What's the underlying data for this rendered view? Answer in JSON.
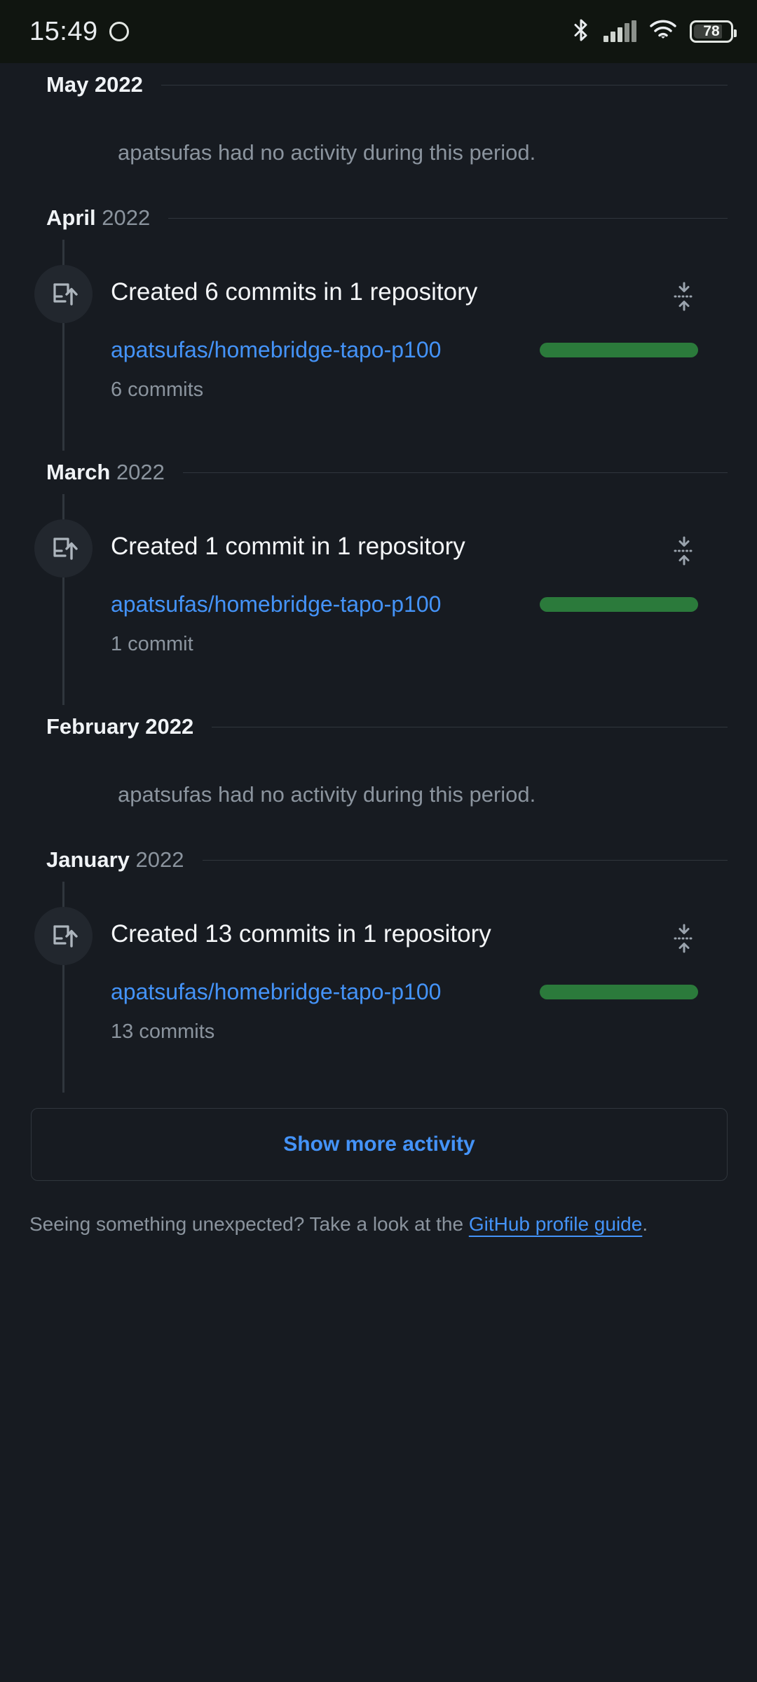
{
  "status_bar": {
    "clock": "15:49",
    "dot_icon": "circle-outline-icon",
    "bluetooth_icon": "bluetooth-icon",
    "signal_icon": "cellular-signal-icon",
    "wifi_icon": "wifi-icon",
    "battery_icon": "battery-icon",
    "battery_level": "78",
    "bg_color": "#101510"
  },
  "theme": {
    "background": "#171b21",
    "text_primary": "#f0f3f6",
    "text_muted": "#8b949e",
    "link": "#4493f8",
    "rule": "#30363d",
    "commit_bar_green": "#2b7a3b",
    "badge_bg": "#22272e"
  },
  "timeline": {
    "months": [
      {
        "month": "May",
        "year": "2022",
        "year_muted": false,
        "has_activity": false,
        "empty_message": "apatsufas had no activity during this period."
      },
      {
        "month": "April",
        "year": "2022",
        "year_muted": true,
        "has_activity": true,
        "entry": {
          "icon": "repo-push-icon",
          "title": "Created 6 commits in 1 repository",
          "fold_icon": "fold-collapse-icon",
          "repo": "apatsufas/homebridge-tapo-p100",
          "bar_color": "#2b7a3b",
          "count_label": "6 commits"
        }
      },
      {
        "month": "March",
        "year": "2022",
        "year_muted": true,
        "has_activity": true,
        "entry": {
          "icon": "repo-push-icon",
          "title": "Created 1 commit in 1 repository",
          "fold_icon": "fold-collapse-icon",
          "repo": "apatsufas/homebridge-tapo-p100",
          "bar_color": "#2b7a3b",
          "count_label": "1 commit"
        }
      },
      {
        "month": "February",
        "year": "2022",
        "year_muted": false,
        "has_activity": false,
        "empty_message": "apatsufas had no activity during this period."
      },
      {
        "month": "January",
        "year": "2022",
        "year_muted": true,
        "has_activity": true,
        "entry": {
          "icon": "repo-push-icon",
          "title": "Created 13 commits in 1 repository",
          "fold_icon": "fold-collapse-icon",
          "repo": "apatsufas/homebridge-tapo-p100",
          "bar_color": "#2b7a3b",
          "count_label": "13 commits"
        }
      }
    ]
  },
  "show_more": {
    "label": "Show more activity"
  },
  "footer": {
    "text_before": "Seeing something unexpected? Take a look at the ",
    "link_text": "GitHub profile guide",
    "text_after": "."
  }
}
